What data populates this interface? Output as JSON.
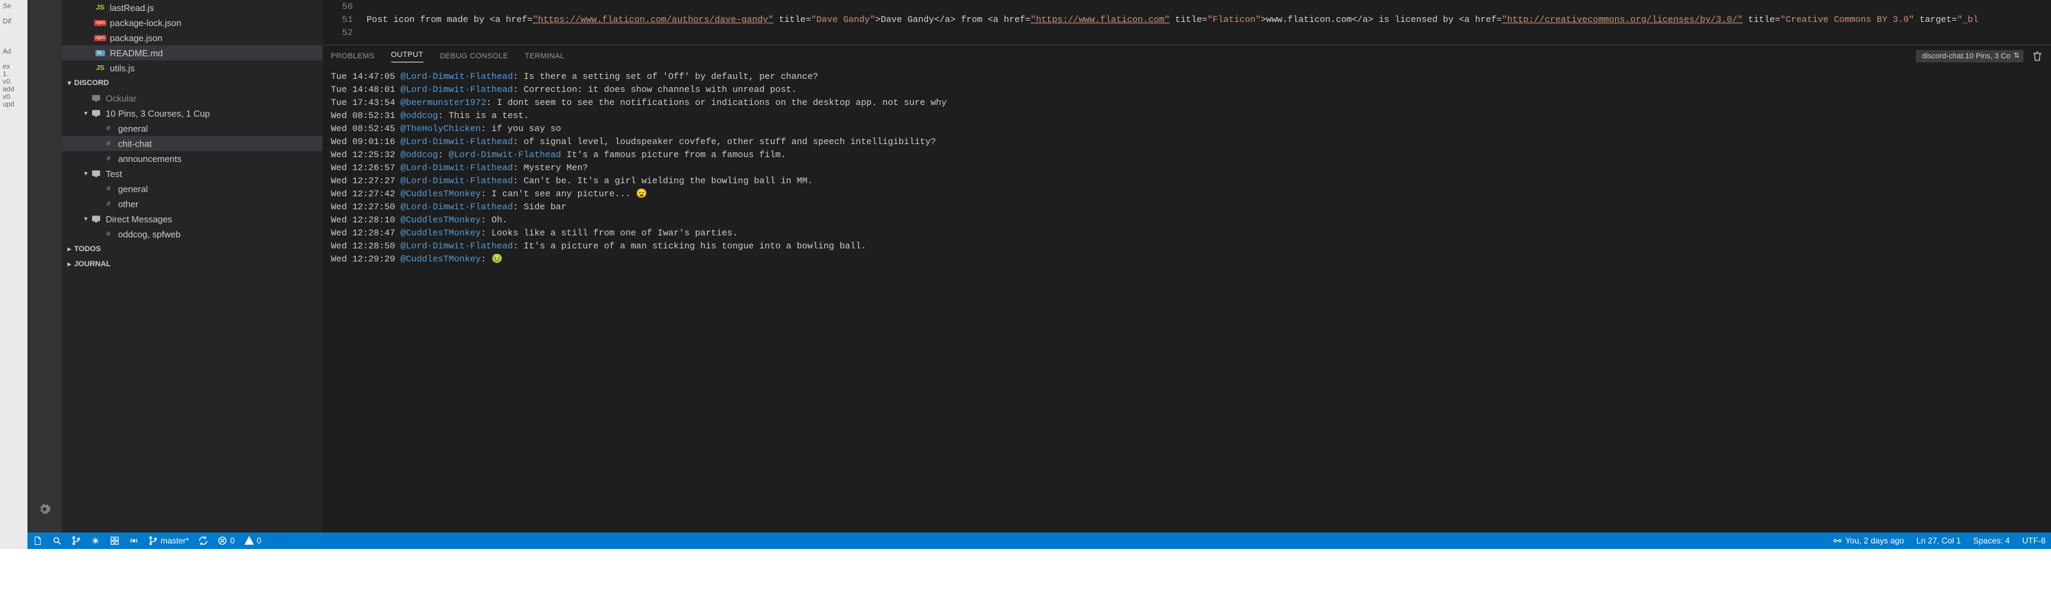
{
  "sidebar": {
    "files": [
      {
        "name": "lastRead.js",
        "type": "js"
      },
      {
        "name": "package-lock.json",
        "type": "npm"
      },
      {
        "name": "package.json",
        "type": "npm"
      },
      {
        "name": "README.md",
        "type": "md"
      },
      {
        "name": "utils.js",
        "type": "js"
      }
    ],
    "discord_label": "DISCORD",
    "servers": [
      {
        "name_top": "Ockular",
        "name": "10 Pins, 3 Courses, 1 Cup",
        "channels": [
          "general",
          "chit-chat",
          "announcements"
        ]
      },
      {
        "name": "Test",
        "channels": [
          "general",
          "other"
        ]
      }
    ],
    "dm_label": "Direct Messages",
    "dm_items": [
      "oddcog, spfweb"
    ],
    "todos_label": "TODOS",
    "journal_label": "JOURNAL"
  },
  "editor": {
    "lines": [
      {
        "num": "50",
        "html": ""
      },
      {
        "num": "51",
        "html": "    Post icon from made by &lt;a href=<span class='link'>\"https://www.flaticon.com/authors/dave-gandy\"</span> title=<span class='str'>\"Dave Gandy\"</span>&gt;Dave Gandy&lt;/a&gt; from &lt;a href=<span class='link'>\"https://www.flaticon.com\"</span> title=<span class='str'>\"Flaticon\"</span>&gt;www.flaticon.com&lt;/a&gt; is licensed by &lt;a href=<span class='link'>\"http://creativecommons.org/licenses/by/3.0/\"</span> title=<span class='str'>\"Creative Commons BY 3.0\"</span> target=<span class='str'>\"_bl</span>"
      },
      {
        "num": "52",
        "html": ""
      }
    ]
  },
  "panel": {
    "tabs": {
      "problems": "PROBLEMS",
      "output": "OUTPUT",
      "debug": "DEBUG CONSOLE",
      "terminal": "TERMINAL"
    },
    "dropdown": "discord-chat.10 Pins, 3 Co"
  },
  "output": [
    {
      "ts": "Tue 14:47:05",
      "user": "@Lord·Dimwit·Flathead",
      "msg": ": Is there a setting set of 'Off' by default, per chance?"
    },
    {
      "ts": "Tue 14:48:01",
      "user": "@Lord·Dimwit·Flathead",
      "msg": ": Correction: it does show channels with unread post."
    },
    {
      "ts": "Tue 17:43:54",
      "user": "@beermunster1972",
      "msg": ": I dont seem to see the notifications or indications on the desktop app. not sure why"
    },
    {
      "ts": "Wed 08:52:31",
      "user": "@oddcog",
      "msg": ": This is a test."
    },
    {
      "ts": "Wed 08:52:45",
      "user": "@TheHolyChicken",
      "msg": ": if you say so"
    },
    {
      "ts": "Wed 09:01:16",
      "user": "@Lord·Dimwit·Flathead",
      "msg": ": of signal level, loudspeaker covfefe, other stuff and speech intelligibility?"
    },
    {
      "ts": "Wed 12:25:32",
      "user": "@oddcog",
      "msg": ": ",
      "mention": "@Lord·Dimwit·Flathead",
      "tail": " It's a famous picture from a famous film."
    },
    {
      "ts": "Wed 12:26:57",
      "user": "@Lord·Dimwit·Flathead",
      "msg": ": Mystery Men?"
    },
    {
      "ts": "Wed 12:27:27",
      "user": "@Lord·Dimwit·Flathead",
      "msg": ": Can't be. It's a girl wielding the bowling ball in MM."
    },
    {
      "ts": "Wed 12:27:42",
      "user": "@CuddlesTMonkey",
      "msg": ": I can't see any picture... 😦"
    },
    {
      "ts": "Wed 12:27:50",
      "user": "@Lord·Dimwit·Flathead",
      "msg": ": Side bar"
    },
    {
      "ts": "Wed 12:28:10",
      "user": "@CuddlesTMonkey",
      "msg": ": Oh."
    },
    {
      "ts": "Wed 12:28:47",
      "user": "@CuddlesTMonkey",
      "msg": ": Looks like a still from one of Iwar's parties."
    },
    {
      "ts": "Wed 12:28:50",
      "user": "@Lord·Dimwit·Flathead",
      "msg": ": It's a picture of a man sticking his tongue into a bowling ball."
    },
    {
      "ts": "Wed 12:29:29",
      "user": "@CuddlesTMonkey",
      "msg": ": 🤢"
    }
  ],
  "status": {
    "branch": "master*",
    "errors": "0",
    "warnings": "0",
    "blame": "You, 2 days ago",
    "cursor": "Ln 27, Col 1",
    "spaces": "Spaces: 4",
    "encoding": "UTF-8"
  }
}
